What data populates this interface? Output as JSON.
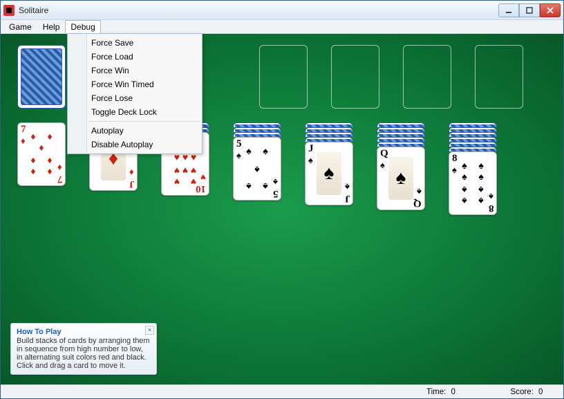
{
  "window": {
    "title": "Solitaire"
  },
  "menubar": {
    "items": [
      "Game",
      "Help",
      "Debug"
    ],
    "open_index": 2
  },
  "debug_menu": {
    "group1": [
      "Force Save",
      "Force Load",
      "Force Win",
      "Force Win Timed",
      "Force Lose",
      "Toggle Deck Lock"
    ],
    "group2": [
      "Autoplay",
      "Disable Autoplay"
    ]
  },
  "tableau": [
    {
      "hidden": 0,
      "top": {
        "rank": "7",
        "suit": "diamonds",
        "color": "red"
      }
    },
    {
      "hidden": 1,
      "top": {
        "rank": "J",
        "suit": "diamonds",
        "color": "red",
        "face": true
      }
    },
    {
      "hidden": 2,
      "top": {
        "rank": "10",
        "suit": "hearts",
        "color": "red"
      }
    },
    {
      "hidden": 3,
      "top": {
        "rank": "5",
        "suit": "spades",
        "color": "black"
      }
    },
    {
      "hidden": 4,
      "top": {
        "rank": "J",
        "suit": "spades",
        "color": "black",
        "face": true
      }
    },
    {
      "hidden": 5,
      "top": {
        "rank": "Q",
        "suit": "spades",
        "color": "black",
        "face": true
      }
    },
    {
      "hidden": 6,
      "top": {
        "rank": "8",
        "suit": "spades",
        "color": "black"
      }
    }
  ],
  "howto": {
    "title": "How To Play",
    "body": "Build stacks of cards by arranging them in sequence from high number to low, in alternating suit colors red and black. Click and drag a card to move it."
  },
  "status": {
    "time_label": "Time:",
    "time_value": "0",
    "score_label": "Score:",
    "score_value": "0"
  }
}
